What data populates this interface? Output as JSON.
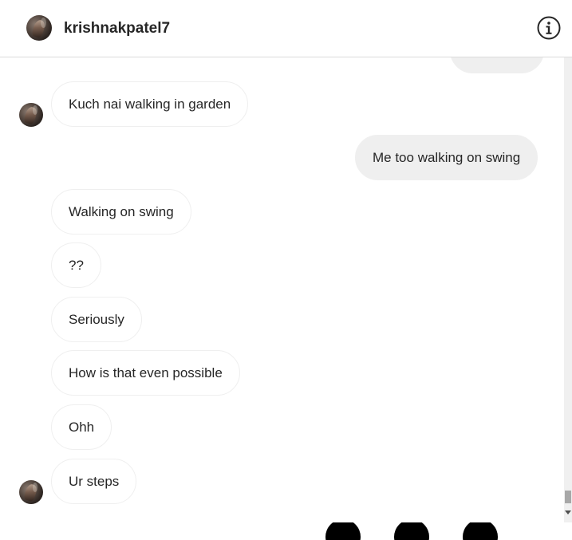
{
  "header": {
    "username": "krishnakpatel7",
    "avatar_icon": "profile-avatar-icon",
    "info_icon": "info-circle-icon"
  },
  "messages": [
    {
      "direction": "out",
      "text": ""
    },
    {
      "direction": "in",
      "text": "Kuch nai walking in garden"
    },
    {
      "direction": "out",
      "text": "Me too walking on swing"
    },
    {
      "direction": "in",
      "text": "Walking on swing"
    },
    {
      "direction": "in",
      "text": "??"
    },
    {
      "direction": "in",
      "text": "Seriously"
    },
    {
      "direction": "in",
      "text": "How is that even possible"
    },
    {
      "direction": "in",
      "text": "Ohh"
    },
    {
      "direction": "in",
      "text": "Ur steps"
    }
  ],
  "colors": {
    "outgoing_bubble": "#efefef",
    "incoming_border": "#efefef",
    "text": "#262626",
    "divider": "#dbdbdb"
  }
}
